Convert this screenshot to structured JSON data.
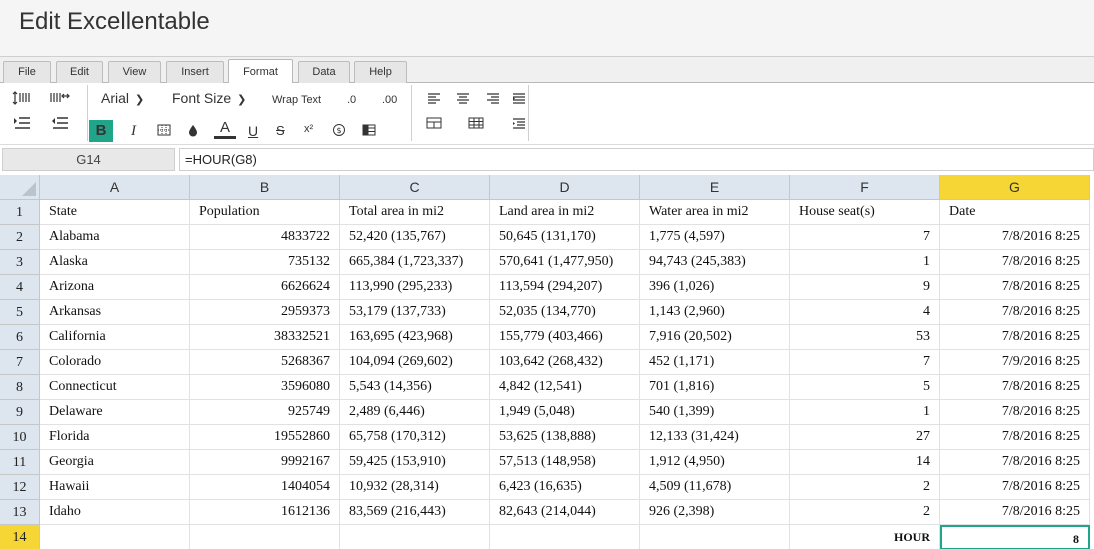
{
  "app": {
    "title": "Edit Excellentable"
  },
  "menu_tabs": [
    {
      "label": "File"
    },
    {
      "label": "Edit"
    },
    {
      "label": "View"
    },
    {
      "label": "Insert"
    },
    {
      "label": "Format",
      "active": true
    },
    {
      "label": "Data"
    },
    {
      "label": "Help"
    }
  ],
  "ribbon": {
    "font_name": "Arial",
    "font_size": "Font Size",
    "wrap_text": "Wrap Text",
    "decrease_decimal": ".0",
    "increase_decimal": ".00",
    "bold": "B",
    "italic": "I",
    "font_color": "A",
    "underline": "U",
    "strikethrough": "S",
    "superscript": "x²",
    "accent_color": "#21a58a"
  },
  "formula_bar": {
    "cell_ref": "G14",
    "formula": "=HOUR(G8)"
  },
  "sheet": {
    "columns": [
      "A",
      "B",
      "C",
      "D",
      "E",
      "F",
      "G"
    ],
    "selected_column": "G",
    "selected_row": "14",
    "rows": [
      {
        "num": "1",
        "cells": [
          "State",
          "Population",
          "Total area in mi2",
          "Land area in mi2",
          "Water area in mi2",
          "House seat(s)",
          "Date"
        ]
      },
      {
        "num": "2",
        "cells": [
          "Alabama",
          "4833722",
          "52,420 (135,767)",
          "50,645 (131,170)",
          "1,775 (4,597)",
          "7",
          "7/8/2016 8:25"
        ]
      },
      {
        "num": "3",
        "cells": [
          "Alaska",
          "735132",
          "665,384 (1,723,337)",
          "570,641 (1,477,950)",
          "94,743 (245,383)",
          "1",
          "7/8/2016 8:25"
        ]
      },
      {
        "num": "4",
        "cells": [
          "Arizona",
          "6626624",
          "113,990 (295,233)",
          "113,594 (294,207)",
          "396 (1,026)",
          "9",
          "7/8/2016 8:25"
        ]
      },
      {
        "num": "5",
        "cells": [
          "Arkansas",
          "2959373",
          "53,179 (137,733)",
          "52,035 (134,770)",
          "1,143 (2,960)",
          "4",
          "7/8/2016 8:25"
        ]
      },
      {
        "num": "6",
        "cells": [
          "California",
          "38332521",
          "163,695 (423,968)",
          "155,779 (403,466)",
          "7,916 (20,502)",
          "53",
          "7/8/2016 8:25"
        ]
      },
      {
        "num": "7",
        "cells": [
          "Colorado",
          "5268367",
          "104,094 (269,602)",
          "103,642 (268,432)",
          "452 (1,171)",
          "7",
          "7/9/2016 8:25"
        ]
      },
      {
        "num": "8",
        "cells": [
          "Connecticut",
          "3596080",
          "5,543 (14,356)",
          "4,842 (12,541)",
          "701 (1,816)",
          "5",
          "7/8/2016 8:25"
        ]
      },
      {
        "num": "9",
        "cells": [
          "Delaware",
          "925749",
          "2,489 (6,446)",
          "1,949 (5,048)",
          "540 (1,399)",
          "1",
          "7/8/2016 8:25"
        ]
      },
      {
        "num": "10",
        "cells": [
          "Florida",
          "19552860",
          "65,758 (170,312)",
          "53,625 (138,888)",
          "12,133 (31,424)",
          "27",
          "7/8/2016 8:25"
        ]
      },
      {
        "num": "11",
        "cells": [
          "Georgia",
          "9992167",
          "59,425 (153,910)",
          "57,513 (148,958)",
          "1,912 (4,950)",
          "14",
          "7/8/2016 8:25"
        ]
      },
      {
        "num": "12",
        "cells": [
          "Hawaii",
          "1404054",
          "10,932 (28,314)",
          "6,423 (16,635)",
          "4,509 (11,678)",
          "2",
          "7/8/2016 8:25"
        ]
      },
      {
        "num": "13",
        "cells": [
          "Idaho",
          "1612136",
          "83,569 (216,443)",
          "82,643 (214,044)",
          "926 (2,398)",
          "2",
          "7/8/2016 8:25"
        ]
      },
      {
        "num": "14",
        "cells": [
          "",
          "",
          "",
          "",
          "",
          "HOUR",
          "8"
        ]
      }
    ]
  }
}
